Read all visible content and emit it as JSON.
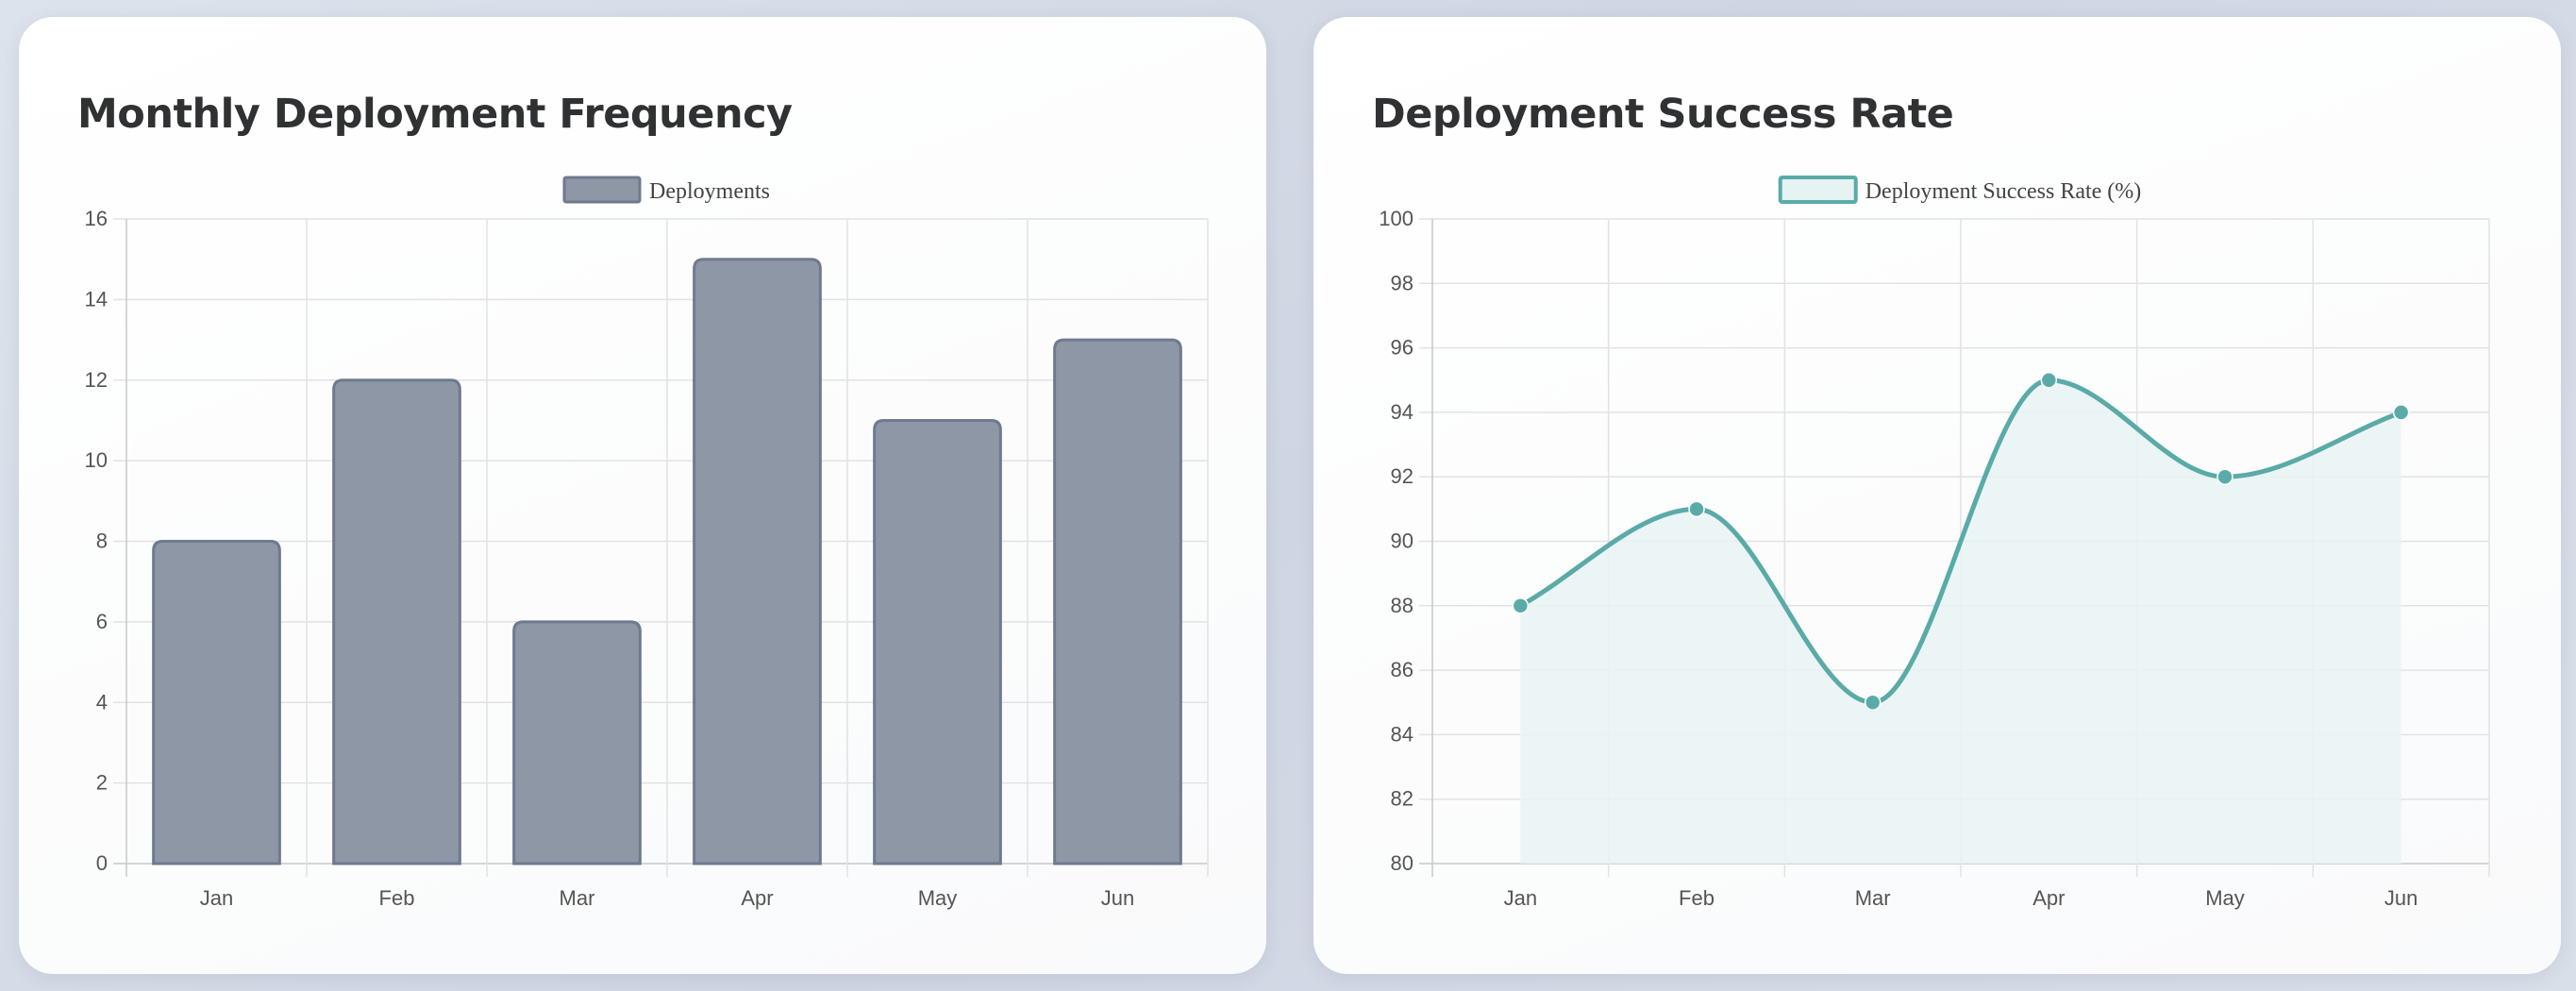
{
  "chart_data": [
    {
      "type": "bar",
      "title": "Monthly Deployment Frequency",
      "categories": [
        "Jan",
        "Feb",
        "Mar",
        "Apr",
        "May",
        "Jun"
      ],
      "series": [
        {
          "name": "Deployments",
          "values": [
            8,
            12,
            6,
            15,
            11,
            13
          ]
        }
      ],
      "ylim": [
        0,
        16
      ],
      "yticks": [
        0,
        2,
        4,
        6,
        8,
        10,
        12,
        14,
        16
      ],
      "grid": true,
      "legend": "top-center",
      "colors": {
        "fill": "#8e97a6",
        "stroke": "#6e7a8f"
      }
    },
    {
      "type": "line",
      "title": "Deployment Success Rate",
      "categories": [
        "Jan",
        "Feb",
        "Mar",
        "Apr",
        "May",
        "Jun"
      ],
      "series": [
        {
          "name": "Deployment Success Rate (%)",
          "values": [
            88,
            91,
            85,
            95,
            92,
            94
          ]
        }
      ],
      "ylim": [
        80,
        100
      ],
      "yticks": [
        80,
        82,
        84,
        86,
        88,
        90,
        92,
        94,
        96,
        98,
        100
      ],
      "grid": true,
      "area_fill": true,
      "smooth": true,
      "legend": "top-center",
      "colors": {
        "line": "#5aaba8",
        "fill": "#e9f3f4",
        "legend_fill": "#e6f3f3"
      }
    }
  ]
}
